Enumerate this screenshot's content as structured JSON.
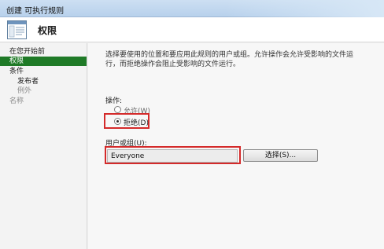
{
  "window": {
    "title": "创建 可执行规则"
  },
  "header": {
    "title": "权限",
    "icon": "document-list-icon"
  },
  "sidebar": {
    "items": [
      {
        "label": "在您开始前"
      },
      {
        "label": "权限"
      },
      {
        "label": "条件"
      },
      {
        "label": "发布者"
      },
      {
        "label": "例外"
      },
      {
        "label": "名称"
      }
    ]
  },
  "main": {
    "description_line1": "选择要使用的位置和要应用此规则的用户或组。允许操作会允许受影响的文件运",
    "description_line2": "行，而拒绝操作会阻止受影响的文件运行。",
    "action_label": "操作:",
    "options": [
      {
        "label": "允许(W)",
        "selected": false
      },
      {
        "label": "拒绝(D)",
        "selected": true
      }
    ],
    "user_label": "用户或组(U):",
    "user_value": "Everyone",
    "select_button": "选择(S)..."
  },
  "colors": {
    "active_nav": "#1f7a27",
    "highlight": "#d42a2a"
  }
}
